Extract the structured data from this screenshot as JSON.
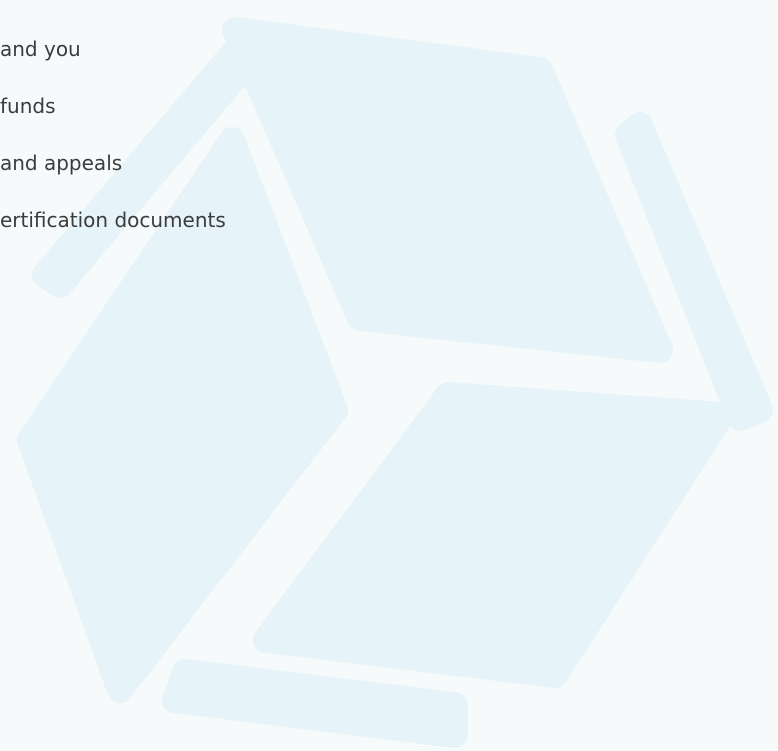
{
  "menu": {
    "items": [
      {
        "label": "and you"
      },
      {
        "label": "funds"
      },
      {
        "label": "and appeals"
      },
      {
        "label": "ertification documents"
      }
    ]
  },
  "watermark": {
    "icon": "cube-logo-icon",
    "color": "#e6f3f8"
  },
  "colors": {
    "background": "#f7fafb",
    "text": "#3a3d40"
  }
}
